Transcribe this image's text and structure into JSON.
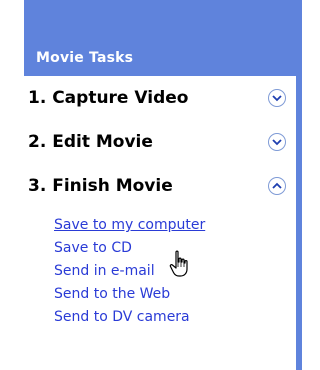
{
  "panel": {
    "title": "Movie Tasks",
    "tasks": [
      {
        "label": "1. Capture Video",
        "state": "collapsed"
      },
      {
        "label": "2. Edit Movie",
        "state": "collapsed"
      },
      {
        "label": "3. Finish Movie",
        "state": "expanded"
      }
    ],
    "finish_links": [
      {
        "label": "Save to my computer",
        "hovered": true
      },
      {
        "label": "Save to CD",
        "hovered": false
      },
      {
        "label": "Send in e-mail",
        "hovered": false
      },
      {
        "label": "Send to the Web",
        "hovered": false
      },
      {
        "label": "Send to DV camera",
        "hovered": false
      }
    ]
  },
  "colors": {
    "panel_blue": "#5f83dc",
    "link_blue": "#2a3bd6",
    "header_text": "#ffffff"
  },
  "icons": {
    "collapsed": "chevron-down-icon",
    "expanded": "chevron-up-icon",
    "cursor": "hand-pointer-icon"
  }
}
